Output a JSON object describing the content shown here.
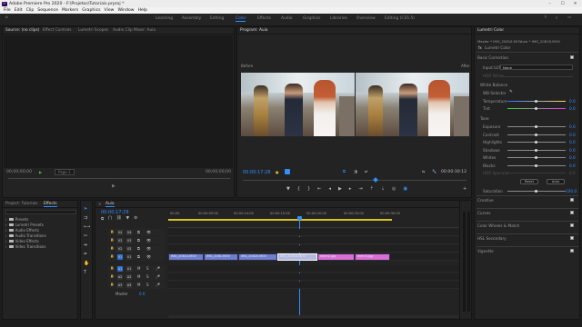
{
  "window": {
    "title": "Adobe Premiere Pro 2020 - F:\\Projetos\\Tutoriais.prproj *",
    "app_badge": "Pr",
    "minimize": "–",
    "maximize": "☐",
    "close": "✕"
  },
  "menu": [
    "File",
    "Edit",
    "Clip",
    "Sequence",
    "Markers",
    "Graphics",
    "View",
    "Window",
    "Help"
  ],
  "workspaces": {
    "items": [
      "Learning",
      "Assembly",
      "Editing",
      "Color",
      "Effects",
      "Audio",
      "Graphics",
      "Libraries",
      "Overview",
      "Editing (CS5.5)"
    ],
    "active": "Color"
  },
  "source_panel": {
    "tabs": [
      "Source: (no clips)",
      "Effect Controls",
      "Lumetri Scopes",
      "Audio Clip Mixer: Auia"
    ],
    "timecode_left": "00;00;00;00",
    "timecode_right": "00;00;00;00",
    "page": "Page 1"
  },
  "program_panel": {
    "tab": "Program: Auia",
    "label_before": "Before",
    "label_after": "After",
    "timecode": "00:00:17:28",
    "fit": "Fit",
    "quality": "Full",
    "duration": "00:00:30:12"
  },
  "project_panel": {
    "tabs": [
      "Project: Tutoriais",
      "Effects"
    ],
    "active_tab": "Effects",
    "items": [
      "Presets",
      "Lumetri Presets",
      "Audio Effects",
      "Audio Transitions",
      "Video Effects",
      "Video Transitions"
    ]
  },
  "timeline": {
    "tab": "Auia",
    "timecode": "00:00:17:29",
    "ruler": [
      "00:00",
      "00:00:05:00",
      "00:00:10:00",
      "00:00:15:00",
      "00:00:20:00",
      "00:00:25:00",
      "00:00:30:00"
    ],
    "video_tracks": [
      "V4",
      "V3",
      "V2",
      "V1"
    ],
    "audio_tracks": [
      "A1",
      "A2",
      "A3"
    ],
    "master": "Master",
    "master_value": "0.0",
    "clips": [
      {
        "name": "IMG_20614.MOV",
        "color": "#6d7fce"
      },
      {
        "name": "IMG_2061.MOV",
        "color": "#6d7fce"
      },
      {
        "name": "IMG_20620.MOV",
        "color": "#6d7fce"
      },
      {
        "name": "IMG_20616.MOV",
        "color": "#b3b9df"
      },
      {
        "name": "mem2.jpg",
        "color": "#d96ed4"
      },
      {
        "name": "mem3.jpg",
        "color": "#d96ed4"
      }
    ]
  },
  "lumetri": {
    "tab": "Lumetri Color",
    "breadcrumb_master": "Master * IMG_20816.MOV",
    "breadcrumb_seq": "Auia * IMG_20816.MOV",
    "effect_name": "Lumetri Color",
    "basic_correction": "Basic Correction",
    "input_lut_label": "Input LUT",
    "input_lut_value": "None",
    "hdr_label": "HDR White",
    "white_balance": "White Balance",
    "wb_selector": "WB Selector",
    "temperature": "Temperature",
    "temperature_value": "0.0",
    "tint": "Tint",
    "tint_value": "0.0",
    "tone": "Tone",
    "tone_rows": [
      {
        "name": "Exposure",
        "value": "0.0"
      },
      {
        "name": "Contrast",
        "value": "0.0"
      },
      {
        "name": "Highlights",
        "value": "0.0"
      },
      {
        "name": "Shadows",
        "value": "0.0"
      },
      {
        "name": "Whites",
        "value": "0.0"
      },
      {
        "name": "Blacks",
        "value": "0.0"
      },
      {
        "name": "HDR Specular",
        "value": "0.0"
      }
    ],
    "reset": "Reset",
    "auto": "Auto",
    "saturation": "Saturation",
    "saturation_value": "100.0",
    "sections": [
      "Creative",
      "Curves",
      "Color Wheels & Match",
      "HSL Secondary",
      "Vignette"
    ]
  },
  "colors": {
    "accent": "#2f8fff",
    "playhead": "#2f8fff",
    "work_area": "#d8c21f",
    "video_clip": "#6d7fce",
    "still_clip": "#d96ed4"
  }
}
